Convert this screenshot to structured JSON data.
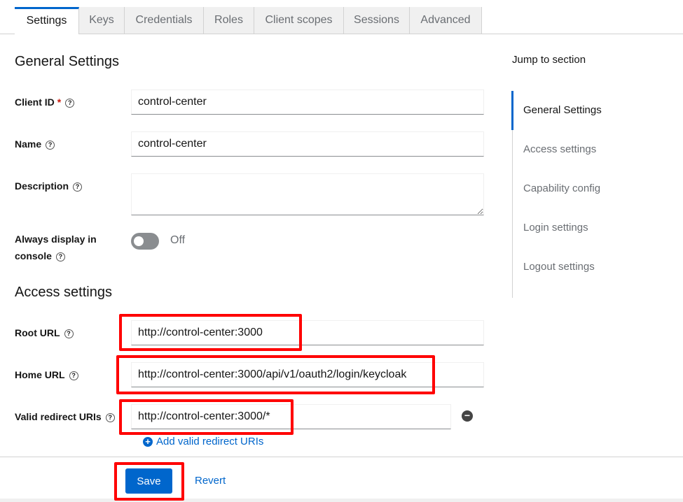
{
  "tabs": [
    "Settings",
    "Keys",
    "Credentials",
    "Roles",
    "Client scopes",
    "Sessions",
    "Advanced"
  ],
  "general": {
    "heading": "General Settings",
    "client_id_label": "Client ID",
    "required_mark": "*",
    "client_id": "control-center",
    "name_label": "Name",
    "name": "control-center",
    "description_label": "Description",
    "description": "",
    "always_display_label": "Always display in console",
    "toggle_state": "Off"
  },
  "access": {
    "heading": "Access settings",
    "root_url_label": "Root URL",
    "root_url": "http://control-center:3000",
    "home_url_label": "Home URL",
    "home_url": "http://control-center:3000/api/v1/oauth2/login/keycloak",
    "redirect_label": "Valid redirect URIs",
    "redirect_uri": "http://control-center:3000/*",
    "add_redirect": "Add valid redirect URIs"
  },
  "footer": {
    "save": "Save",
    "revert": "Revert"
  },
  "jump": {
    "title": "Jump to section",
    "items": [
      "General Settings",
      "Access settings",
      "Capability config",
      "Login settings",
      "Logout settings"
    ]
  },
  "colors": {
    "accent": "#0066cc",
    "annotation": "#ff0000"
  }
}
